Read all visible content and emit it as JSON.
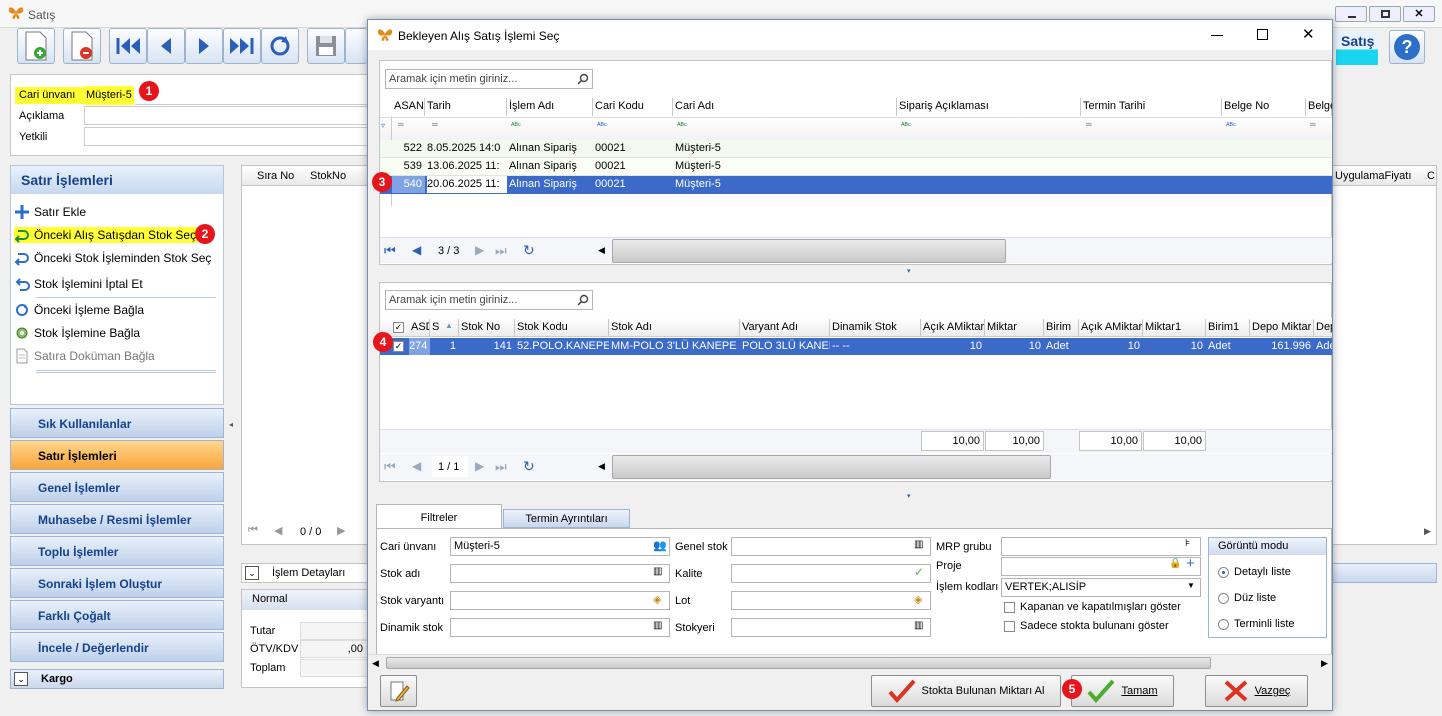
{
  "main": {
    "title": "Satış",
    "header_title": "Satış",
    "fields": {
      "cari_label": "Cari ünvanı",
      "cari_value": "Müşteri-5",
      "aciklama_label": "Açıklama",
      "yetkili_label": "Yetkili"
    },
    "actions": {
      "title": "Satır İşlemleri",
      "items": [
        {
          "label": "Satır Ekle"
        },
        {
          "label": "Önceki Alış Satışdan Stok Seç"
        },
        {
          "label": "Önceki Stok İşleminden Stok Seç"
        },
        {
          "label": "Stok İşlemini İptal Et"
        },
        {
          "label": "Önceki İşleme Bağla"
        },
        {
          "label": "Stok İşlemine Bağla"
        },
        {
          "label": "Satıra Doküman Bağla"
        }
      ]
    },
    "nav": [
      {
        "label": "Sık Kullanılanlar"
      },
      {
        "label": "Satır İşlemleri"
      },
      {
        "label": "Genel İşlemler"
      },
      {
        "label": "Muhasebe / Resmi İşlemler"
      },
      {
        "label": "Toplu İşlemler"
      },
      {
        "label": "Sonraki İşlem Oluştur"
      },
      {
        "label": "Farklı Çoğalt"
      },
      {
        "label": "İncele / Değerlendir"
      },
      {
        "label": "Kargo"
      }
    ],
    "grid": {
      "col1": "Sıra No",
      "col2": "StokNo",
      "col_right": "UygulamaFiyatı",
      "col_c": "C",
      "pager": "0 / 0"
    },
    "detail": {
      "islem_detaylari": "İşlem Detayları",
      "normal": "Normal",
      "tutar": "Tutar",
      "otv": "ÖTV/KDV",
      "otv_value": ",00",
      "toplam": "Toplam"
    }
  },
  "dialog": {
    "title": "Bekleyen Alış Satış İşlemi Seç",
    "search_placeholder": "Aramak için metin giriniz...",
    "grid1": {
      "columns": [
        "ASAN",
        "Tarih",
        "İşlem Adı",
        "Cari Kodu",
        "Cari Adı",
        "Sipariş Açıklaması",
        "Termin Tarihi",
        "Belge No",
        "Belge"
      ],
      "rows": [
        {
          "asan": "522",
          "tarih": "8.05.2025 14:0",
          "islem": "Alınan Sipariş",
          "cari_kodu": "00021",
          "cari_adi": "Müşteri-5"
        },
        {
          "asan": "539",
          "tarih": "13.06.2025 11:",
          "islem": "Alınan Sipariş",
          "cari_kodu": "00021",
          "cari_adi": "Müşteri-5"
        },
        {
          "asan": "540",
          "tarih": "20.06.2025 11:",
          "islem": "Alınan Sipariş",
          "cari_kodu": "00021",
          "cari_adi": "Müşteri-5"
        }
      ],
      "pager": "3 / 3"
    },
    "grid2": {
      "columns": [
        "ASD",
        "S",
        "Stok No",
        "Stok Kodu",
        "Stok Adı",
        "Varyant Adı",
        "Dinamik Stok",
        "Açık AMiktar",
        "Miktar",
        "Birim",
        "Açık AMiktar",
        "Miktar1",
        "Birim1",
        "Depo Miktar",
        "Dep"
      ],
      "row": {
        "asd": "274",
        "s": "1",
        "stok_no": "141",
        "stok_kodu": "52.POLO.KANEPE",
        "stok_adi": "MM-POLO 3'LÜ KANEPE",
        "varyant": "POLO 3LÜ KANEPE",
        "dinamik": "-- --",
        "acik": "10",
        "miktar": "10",
        "birim": "Adet",
        "acik2": "10",
        "miktar1": "10",
        "birim1": "Adet",
        "depo": "161.996",
        "dep": "Ade"
      },
      "totals": [
        "10,00",
        "10,00",
        "10,00",
        "10,00"
      ],
      "pager": "1 / 1"
    },
    "tabs": {
      "filtreler": "Filtreler",
      "termin": "Termin Ayrıntıları"
    },
    "filters": {
      "cari_label": "Cari ünvanı",
      "cari_value": "Müşteri-5",
      "stok_adi": "Stok adı",
      "stok_varyanti": "Stok varyantı",
      "dinamik_stok": "Dinamik stok",
      "genel_stok": "Genel stok",
      "kalite": "Kalite",
      "lot": "Lot",
      "stokyeri": "Stokyeri",
      "mrp": "MRP grubu",
      "proje": "Proje",
      "islem_kodlari": "İşlem kodları",
      "islem_kodlari_value": "VERTEK;ALISİP",
      "chk1": "Kapanan ve kapatılmışları göster",
      "chk2": "Sadece stokta bulunanı göster"
    },
    "view_mode": {
      "title": "Görüntü modu",
      "options": [
        "Detaylı liste",
        "Düz liste",
        "Terminli liste"
      ]
    },
    "buttons": {
      "stokta": "Stokta Bulunan Miktarı Al",
      "tamam": "Tamam",
      "vazgec": "Vazgeç"
    }
  },
  "badges": [
    "1",
    "2",
    "3",
    "4",
    "5"
  ],
  "colors": {
    "accent": "#3f6ec6",
    "badge": "#e8141c",
    "highlight": "#ffff33",
    "selection": "#3b6ac8"
  }
}
